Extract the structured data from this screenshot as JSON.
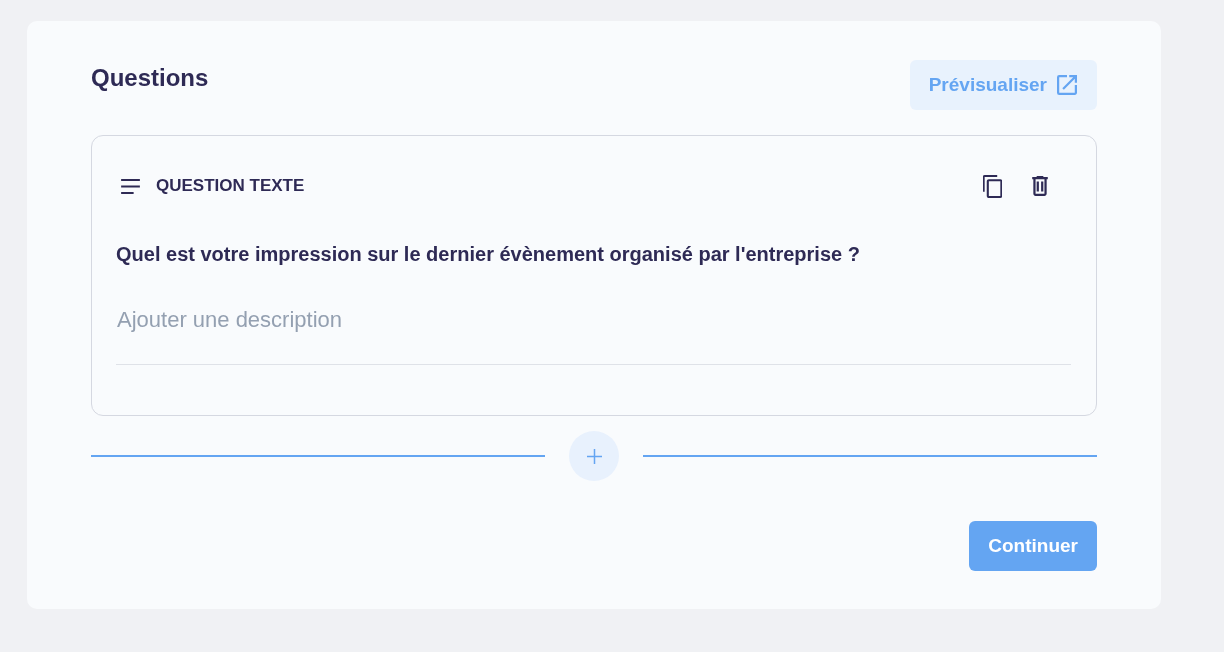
{
  "section": {
    "title": "Questions"
  },
  "preview_button": {
    "label": "Prévisualiser"
  },
  "questions": [
    {
      "kind": "text",
      "type_label": "QUESTION TEXTE",
      "title": "Quel est votre impression sur le dernier évènement organisé par l'entreprise ?",
      "description": {
        "placeholder": "Ajouter une description"
      }
    }
  ],
  "continue_button": {
    "label": "Continuer"
  }
}
